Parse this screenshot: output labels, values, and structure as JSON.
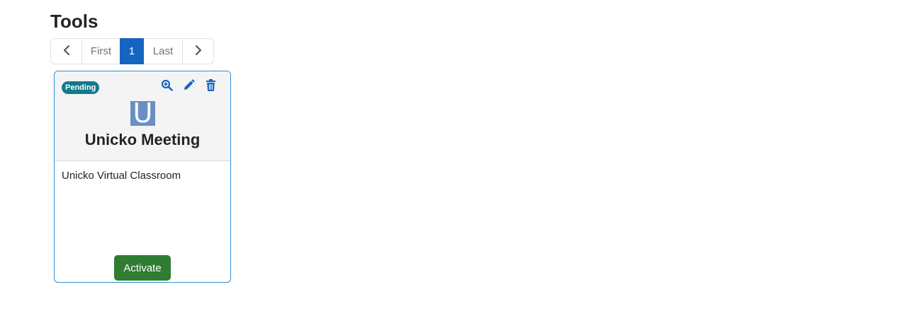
{
  "page": {
    "title": "Tools"
  },
  "pagination": {
    "prev_icon": "chevron-left-icon",
    "first_label": "First",
    "current_page": "1",
    "last_label": "Last",
    "next_icon": "chevron-right-icon"
  },
  "tool_card": {
    "status_badge": "Pending",
    "actions": [
      {
        "name": "view",
        "icon": "zoom-in-icon"
      },
      {
        "name": "edit",
        "icon": "pencil-icon"
      },
      {
        "name": "delete",
        "icon": "trash-icon"
      }
    ],
    "logo_letter": "U",
    "title": "Unicko Meeting",
    "description": "Unicko Virtual Classroom",
    "activate_label": "Activate"
  },
  "colors": {
    "accent": "#1565c0",
    "badge": "#117a8b",
    "activate": "#2e7d32",
    "card_border": "#2f8fd8",
    "logo_bg": "#6b8fc4"
  }
}
